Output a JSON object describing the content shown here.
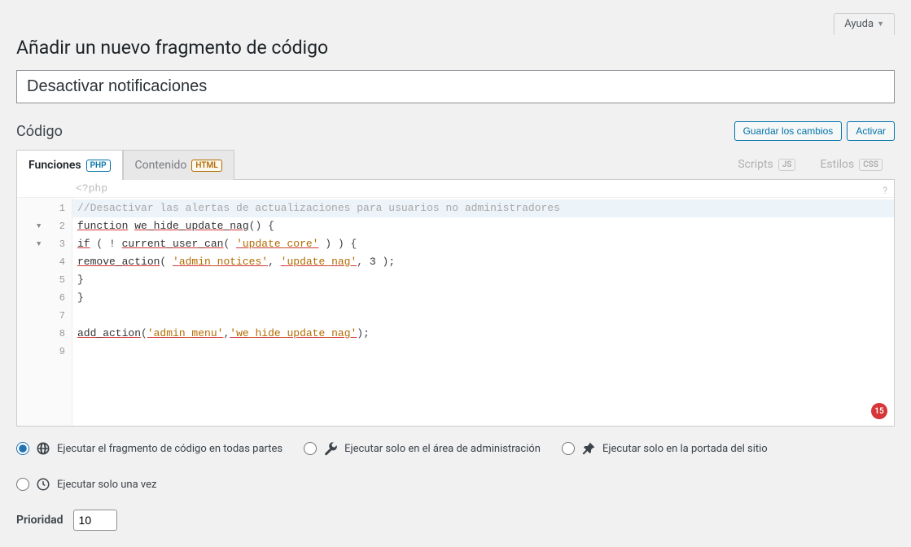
{
  "help_label": "Ayuda",
  "page_title": "Añadir un nuevo fragmento de código",
  "snippet_name": "Desactivar notificaciones",
  "section_code": "Código",
  "buttons": {
    "save": "Guardar los cambios",
    "activate": "Activar"
  },
  "tabs": {
    "functions": "Funciones",
    "functions_badge": "PHP",
    "content": "Contenido",
    "content_badge": "HTML",
    "scripts": "Scripts",
    "scripts_badge": "JS",
    "styles": "Estilos",
    "styles_badge": "CSS"
  },
  "editor": {
    "php_open": "<?php",
    "lines": [
      "//Desactivar las alertas de actualizaciones para usuarios no administradores",
      "function we_hide_update_nag() {",
      "if ( ! current_user_can( 'update_core' ) ) {",
      "remove_action( 'admin_notices', 'update_nag', 3 );",
      "}",
      "}",
      "",
      "add_action('admin_menu','we_hide_update_nag');",
      ""
    ],
    "error_count": "15"
  },
  "scope": {
    "everywhere": "Ejecutar el fragmento de código en todas partes",
    "admin": "Ejecutar solo en el área de administración",
    "frontend": "Ejecutar solo en la portada del sitio",
    "once": "Ejecutar solo una vez"
  },
  "priority": {
    "label": "Prioridad",
    "value": "10"
  }
}
